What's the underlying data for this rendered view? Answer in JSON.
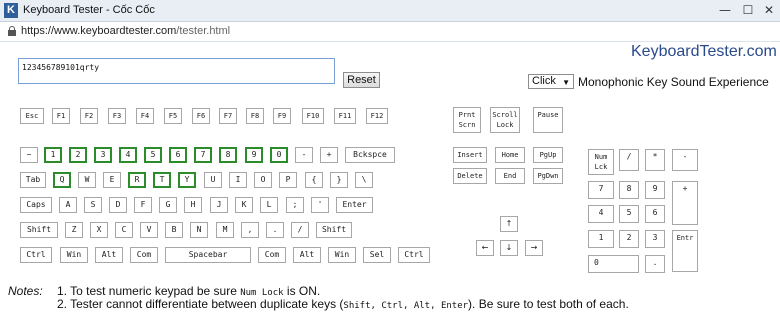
{
  "window": {
    "title": "Keyboard Tester - Cốc Cốc",
    "app_letter": "K",
    "minimize": "—",
    "maximize": "☐",
    "close": "✕"
  },
  "address": {
    "host": "https://www.keyboardtester.com",
    "path": "/tester.html"
  },
  "brand": "KeyboardTester.com",
  "input": {
    "value": "123456789101qrty"
  },
  "reset_label": "Reset",
  "sound": {
    "selected": "Click",
    "arrow": "▼",
    "label": "Monophonic Key Sound Experience"
  },
  "keys": {
    "esc": "Esc",
    "f1": "F1",
    "f2": "F2",
    "f3": "F3",
    "f4": "F4",
    "f5": "F5",
    "f6": "F6",
    "f7": "F7",
    "f8": "F8",
    "f9": "F9",
    "f10": "F10",
    "f11": "F11",
    "f12": "F12",
    "prtsc": "Prnt\nScrn",
    "scroll": "Scroll\nLock",
    "pause": "Pause",
    "tilde": "~",
    "d1": "1",
    "d2": "2",
    "d3": "3",
    "d4": "4",
    "d5": "5",
    "d6": "6",
    "d7": "7",
    "d8": "8",
    "d9": "9",
    "d0": "0",
    "minus": "-",
    "plus": "+",
    "bksp": "Bckspce",
    "tab": "Tab",
    "q": "Q",
    "w": "W",
    "e": "E",
    "r": "R",
    "t": "T",
    "y": "Y",
    "u": "U",
    "i": "I",
    "o": "O",
    "p": "P",
    "lbrace": "{",
    "rbrace": "}",
    "bslash": "\\",
    "caps": "Caps",
    "a": "A",
    "s": "S",
    "d": "D",
    "f": "F",
    "g": "G",
    "h": "H",
    "j": "J",
    "k": "K",
    "l": "L",
    "semi": ";",
    "quote": "'",
    "enter": "Enter",
    "lshift": "Shift",
    "z": "Z",
    "x": "X",
    "c": "C",
    "v": "V",
    "b": "B",
    "n": "N",
    "m": "M",
    "comma": ",",
    "period": ".",
    "slash": "/",
    "rshift": "Shift",
    "lctrl": "Ctrl",
    "lwin": "Win",
    "lalt": "Alt",
    "lcom": "Com",
    "space": "Spacebar",
    "rcom": "Com",
    "ralt": "Alt",
    "rwin": "Win",
    "sel": "Sel",
    "rctrl": "Ctrl",
    "insert": "Insert",
    "home": "Home",
    "pgup": "PgUp",
    "delete": "Delete",
    "end": "End",
    "pgdn": "PgDwn",
    "up": "↑",
    "left": "←",
    "down": "↓",
    "right": "→",
    "numlk": "Num\nLck",
    "ndiv": "/",
    "nmul": "*",
    "nsub": "-",
    "n7": "7",
    "n8": "8",
    "n9": "9",
    "nadd": "+",
    "n4": "4",
    "n5": "5",
    "n6": "6",
    "n1": "1",
    "n2": "2",
    "n3": "3",
    "nent": "Entr",
    "n0": "0",
    "ndot": "."
  },
  "notes": {
    "label": "Notes:",
    "n1_pre": "1. To test numeric keypad be sure ",
    "n1_mono": "Num Lock",
    "n1_post": " is ON.",
    "n2_pre": "2. Tester cannot differentiate between duplicate keys (",
    "n2_mono": "Shift, Ctrl, Alt, Enter",
    "n2_post": "). Be sure to test both of each."
  }
}
